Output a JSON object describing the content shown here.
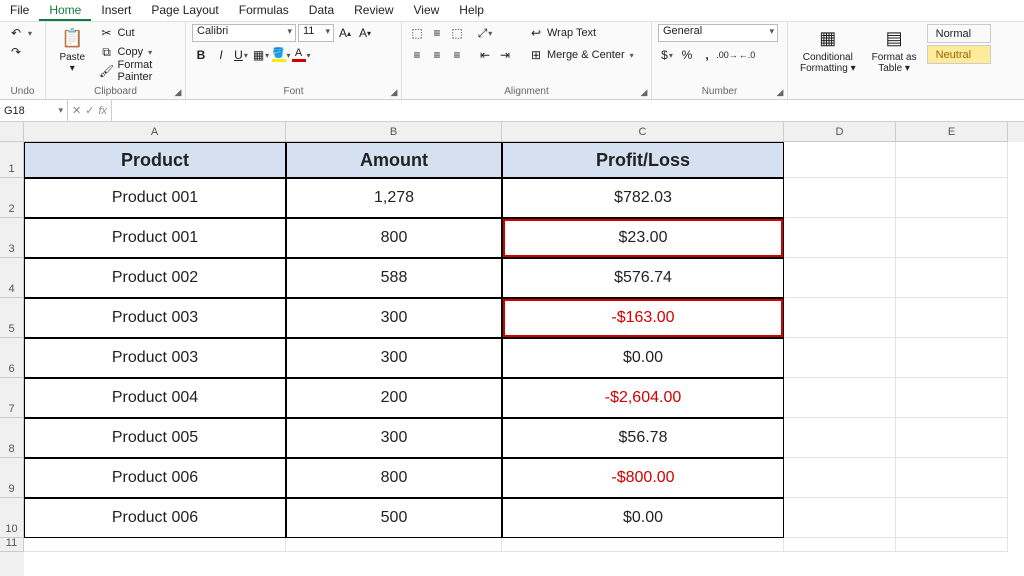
{
  "menu": {
    "items": [
      "File",
      "Home",
      "Insert",
      "Page Layout",
      "Formulas",
      "Data",
      "Review",
      "View",
      "Help"
    ],
    "active": 1
  },
  "ribbon": {
    "undo": {
      "label": "Undo"
    },
    "clipboard": {
      "paste": "Paste",
      "cut": "Cut",
      "copy": "Copy",
      "painter": "Format Painter",
      "label": "Clipboard"
    },
    "font": {
      "name": "Calibri",
      "size": "11",
      "label": "Font"
    },
    "alignment": {
      "wrap": "Wrap Text",
      "merge": "Merge & Center",
      "label": "Alignment"
    },
    "number": {
      "format": "General",
      "label": "Number"
    },
    "styles": {
      "cond": "Conditional\nFormatting",
      "table": "Format as\nTable",
      "normal": "Normal",
      "neutral": "Neutral"
    }
  },
  "fx": {
    "name": "G18",
    "formula": ""
  },
  "cols": [
    "A",
    "B",
    "C",
    "D",
    "E"
  ],
  "rownums": [
    "1",
    "2",
    "3",
    "4",
    "5",
    "6",
    "7",
    "8",
    "9",
    "10",
    "11"
  ],
  "table": {
    "headers": [
      "Product",
      "Amount",
      "Profit/Loss"
    ],
    "rows": [
      {
        "product": "Product 001",
        "amount": "1,278",
        "pl": "$782.03",
        "neg": false,
        "box": false
      },
      {
        "product": "Product 001",
        "amount": "800",
        "pl": "$23.00",
        "neg": false,
        "box": true
      },
      {
        "product": "Product 002",
        "amount": "588",
        "pl": "$576.74",
        "neg": false,
        "box": false
      },
      {
        "product": "Product 003",
        "amount": "300",
        "pl": "-$163.00",
        "neg": true,
        "box": true
      },
      {
        "product": "Product 003",
        "amount": "300",
        "pl": "$0.00",
        "neg": false,
        "box": false
      },
      {
        "product": "Product 004",
        "amount": "200",
        "pl": "-$2,604.00",
        "neg": true,
        "box": false
      },
      {
        "product": "Product 005",
        "amount": "300",
        "pl": "$56.78",
        "neg": false,
        "box": false
      },
      {
        "product": "Product 006",
        "amount": "800",
        "pl": "-$800.00",
        "neg": true,
        "box": false
      },
      {
        "product": "Product 006",
        "amount": "500",
        "pl": "$0.00",
        "neg": false,
        "box": false
      }
    ]
  }
}
